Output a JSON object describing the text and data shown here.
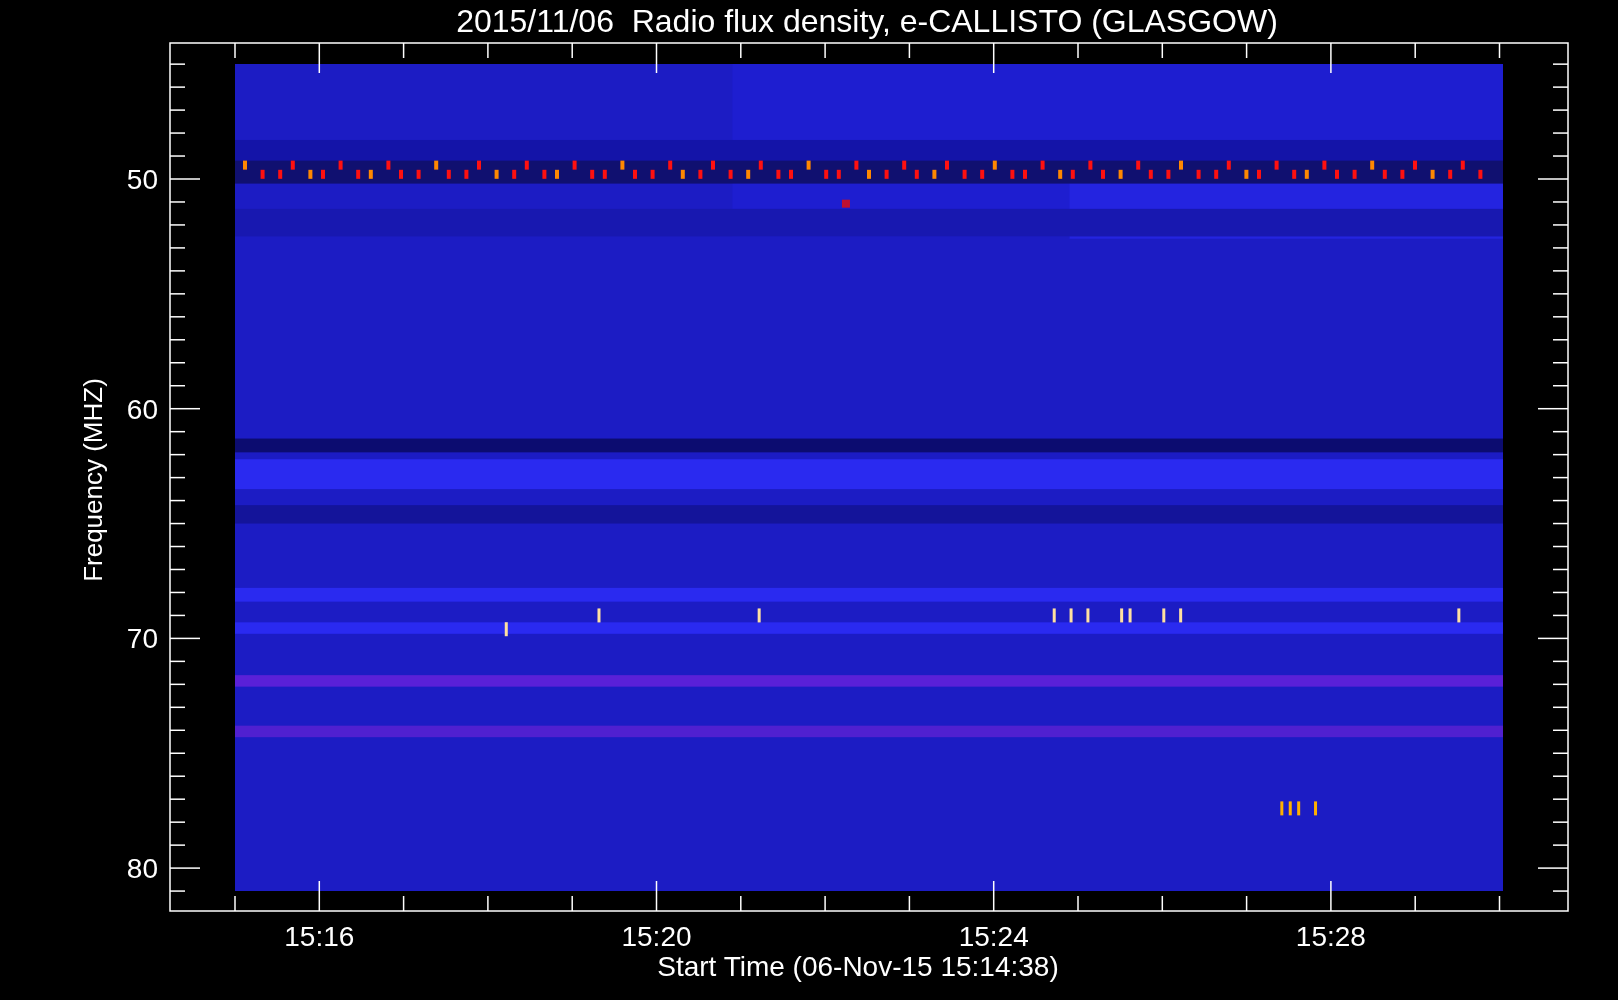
{
  "title": "2015/11/06  Radio flux density, e-CALLISTO (GLASGOW)",
  "y_axis": {
    "label": "Frequency (MHZ)",
    "ticks": [
      "50",
      "60",
      "70",
      "80"
    ]
  },
  "x_axis": {
    "label": "Start Time (06-Nov-15 15:14:38)",
    "ticks": [
      "15:16",
      "15:20",
      "15:24",
      "15:28"
    ]
  }
}
